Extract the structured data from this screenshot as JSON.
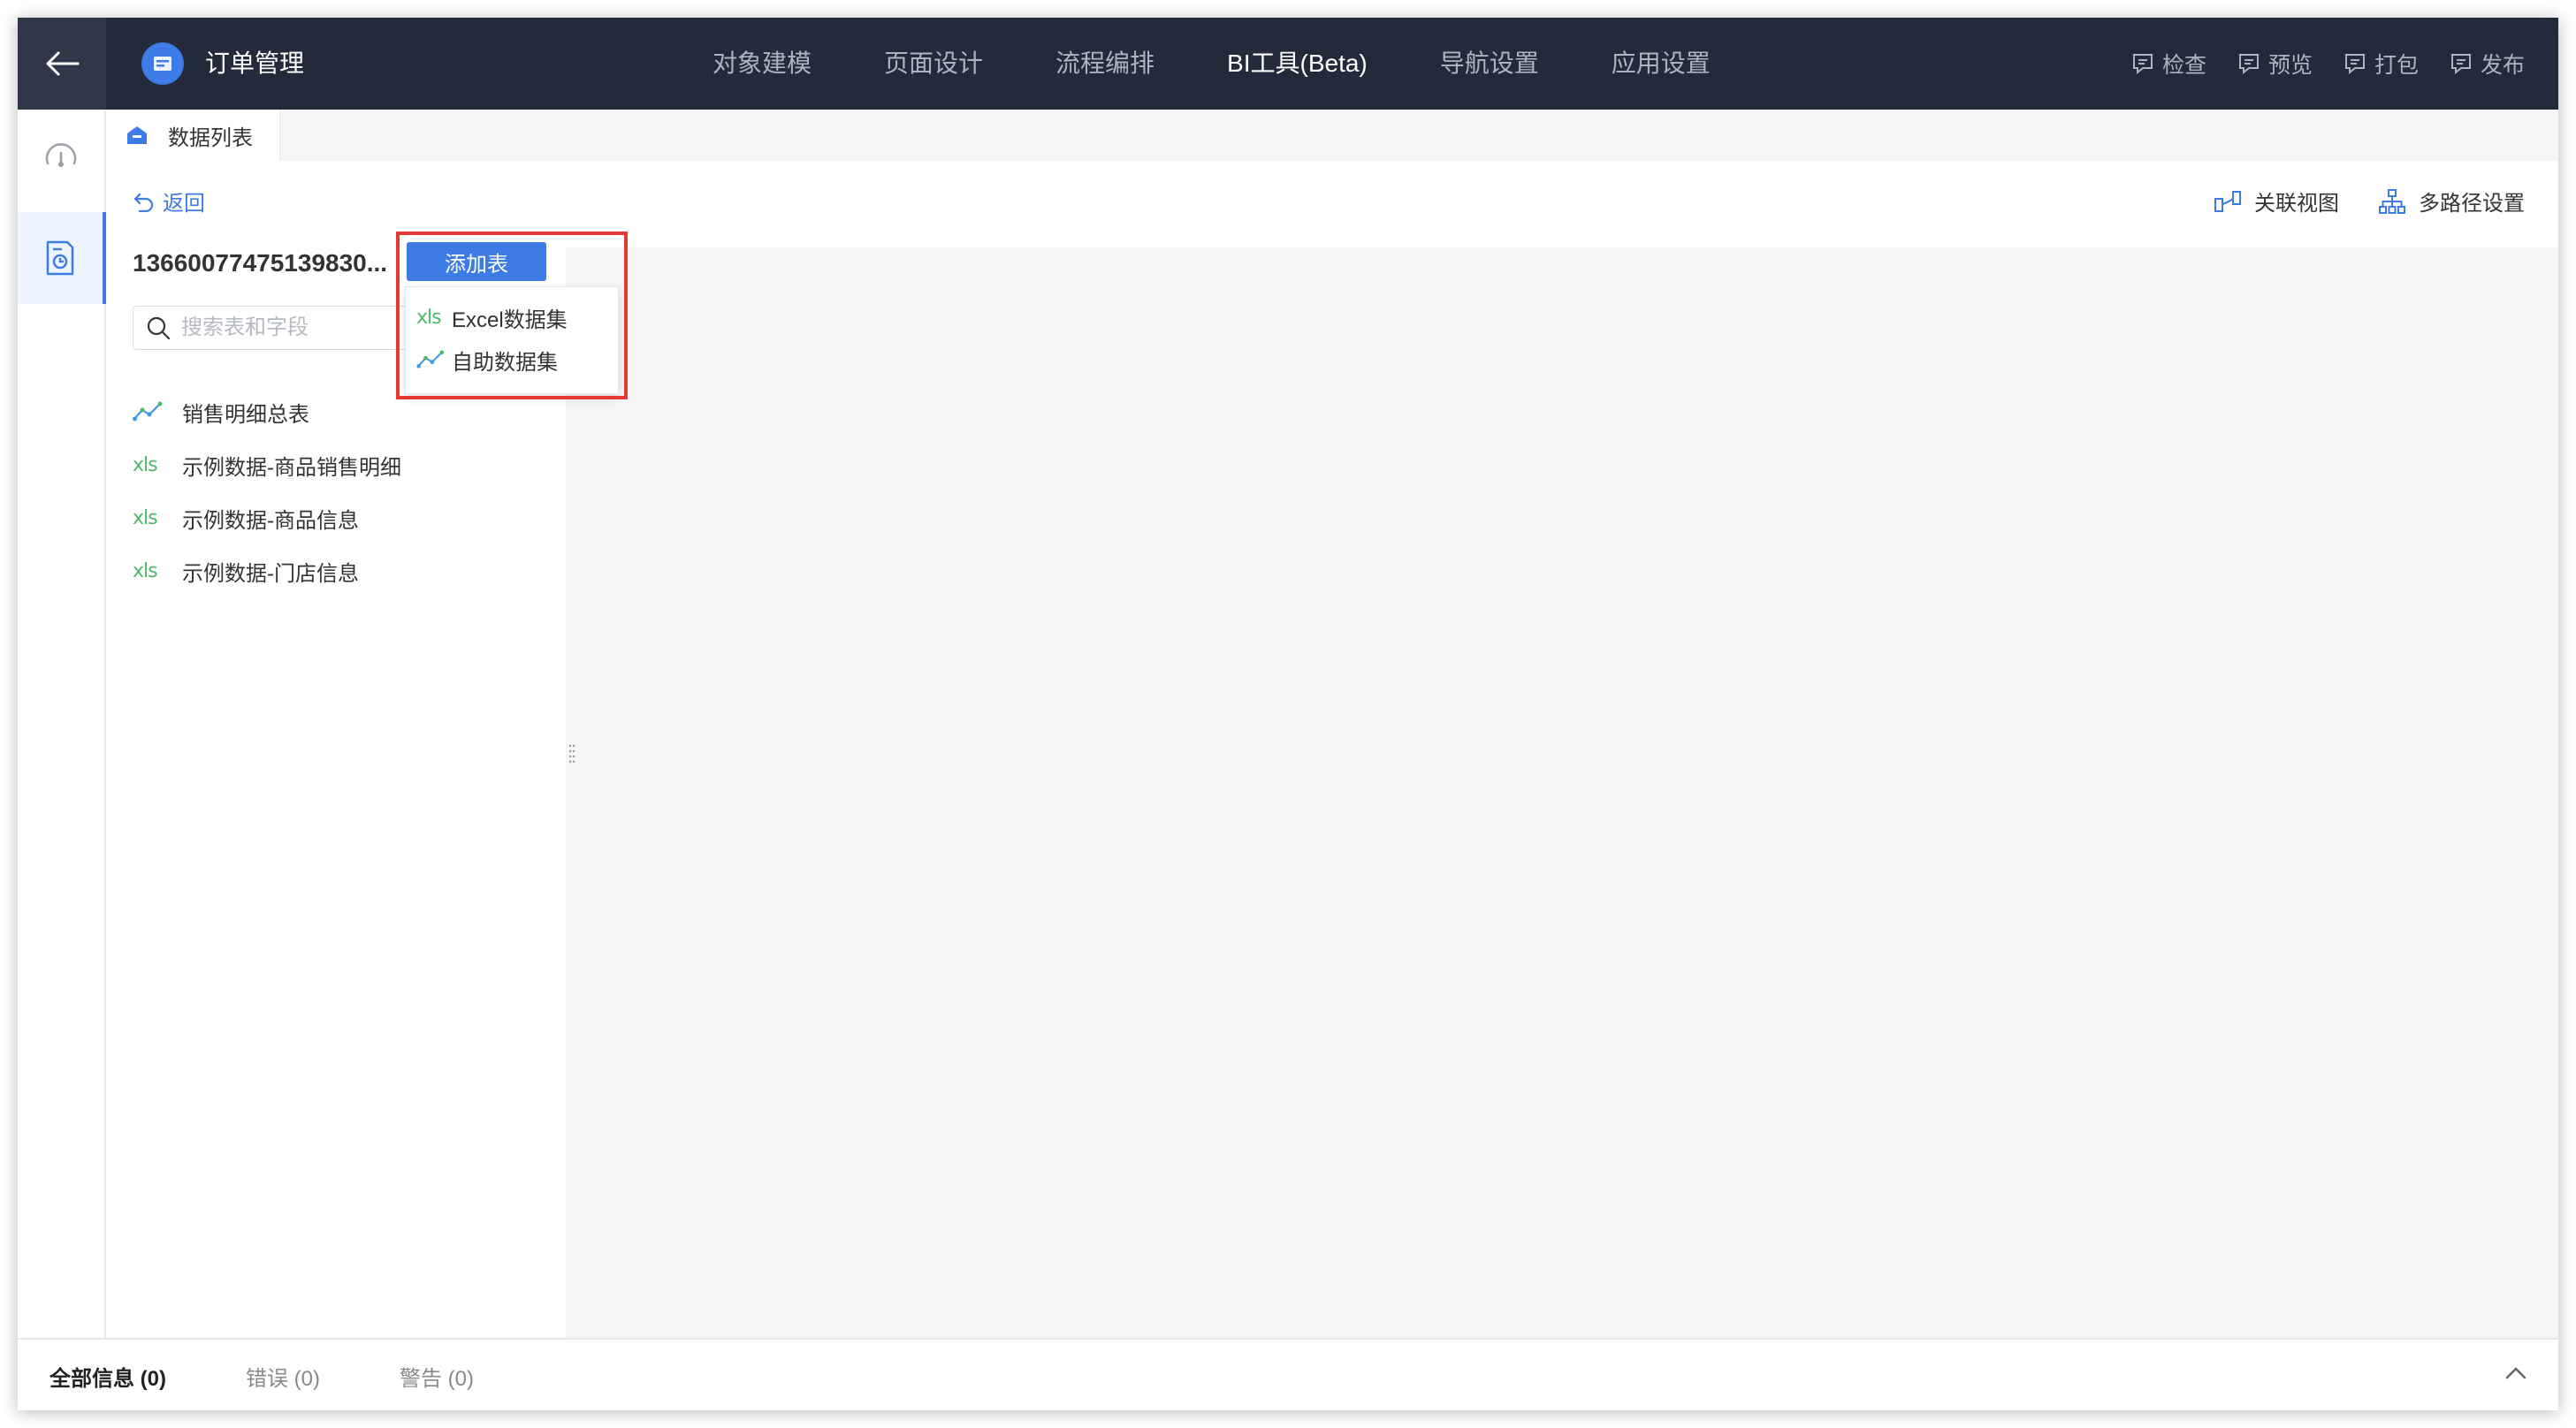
{
  "app": {
    "title": "订单管理"
  },
  "nav": {
    "items": [
      {
        "label": "对象建模",
        "active": false
      },
      {
        "label": "页面设计",
        "active": false
      },
      {
        "label": "流程编排",
        "active": false
      },
      {
        "label": "BI工具(Beta)",
        "active": true
      },
      {
        "label": "导航设置",
        "active": false
      },
      {
        "label": "应用设置",
        "active": false
      }
    ]
  },
  "actions": {
    "check": "检查",
    "preview": "预览",
    "package": "打包",
    "publish": "发布"
  },
  "tabs": {
    "data_list": "数据列表"
  },
  "toolbar": {
    "back": "返回",
    "relation_view": "关联视图",
    "multipath": "多路径设置"
  },
  "panel": {
    "title": "13660077475139830...",
    "search_placeholder": "搜索表和字段",
    "tables": [
      {
        "label": "销售明细总表",
        "icon": "line-chart-icon"
      },
      {
        "label": "示例数据-商品销售明细",
        "icon": "xls-icon"
      },
      {
        "label": "示例数据-商品信息",
        "icon": "xls-icon"
      },
      {
        "label": "示例数据-门店信息",
        "icon": "xls-icon"
      }
    ]
  },
  "add_menu": {
    "button": "添加表",
    "items": [
      {
        "label": "Excel数据集",
        "icon": "xls-icon"
      },
      {
        "label": "自助数据集",
        "icon": "line-chart-icon"
      }
    ]
  },
  "icons": {
    "xls_text": "xls"
  },
  "bottom": {
    "all": "全部信息 (0)",
    "errors": "错误 (0)",
    "warnings": "警告 (0)"
  },
  "colors": {
    "topbar": "#222a3b",
    "accent": "#3d7be6",
    "highlight": "#e53935",
    "xls": "#4db96b"
  }
}
